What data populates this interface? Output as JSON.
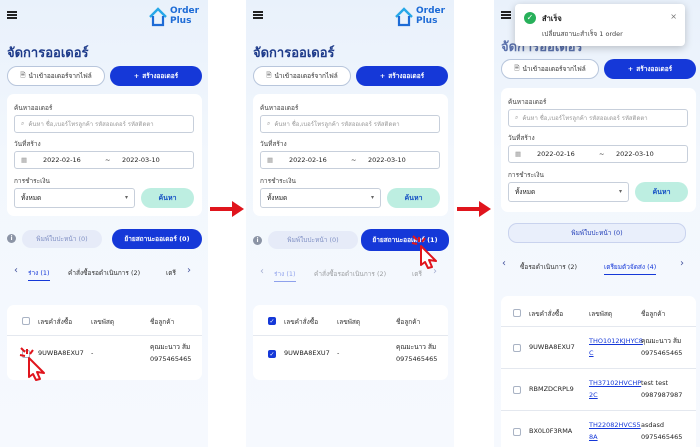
{
  "brand": {
    "line1": "Order",
    "line2": "Plus"
  },
  "page_title": "จัดการออเดอร์",
  "import_button": "นำเข้าออเดอร์จากไฟล์",
  "create_button": "สร้างออเดอร์",
  "search": {
    "label": "ค้นหาออเดอร์",
    "placeholder": "ค้นหา ชื่อ,เบอร์โทรลูกค้า รหัสออเดอร์ รหัสติดตา"
  },
  "date": {
    "label": "วันที่สร้าง",
    "from": "2022-02-16",
    "to": "2022-03-10",
    "sep": "~"
  },
  "payment": {
    "label": "การชำระเงิน",
    "value": "ทั้งหมด"
  },
  "search_button": "ค้นหา",
  "print_button": "พิมพ์ใบปะหน้า (0)",
  "move_button_0": "ย้ายสถานะออเดอร์ (0)",
  "move_button_1": "ย้ายสถานะออเดอร์ (1)",
  "tabs_p1": {
    "t1": "ร่าง (1)",
    "t2": "คำสั่งซื้อรอดำเนินการ (2)",
    "t3": "เตรี"
  },
  "tabs_p3": {
    "t1": "ซื้อรอดำเนินการ (2)",
    "t2": "เตรียมตัวจัดส่ง (4)"
  },
  "list_headers": {
    "order_no": "เลขคำสั่งซื้อ",
    "parcel_no": "เลขพัสดุ",
    "customer": "ชื่อลูกค้า"
  },
  "draft_row": {
    "order_no": "9UWBA8EXU7",
    "parcel_no": "-",
    "customer_name": "คุณมะนาว ส้ม",
    "customer_phone": "0975465465"
  },
  "ship_rows": [
    {
      "order_no": "9UWBA8EXU7",
      "parcel_l1": "THO1012KJHYC8",
      "parcel_l2": "C",
      "customer_l1": "คุณมะนาว ส้ม",
      "customer_l2": "0975465465"
    },
    {
      "order_no": "RBMZDCRPL9",
      "parcel_l1": "TH37102HVCHP",
      "parcel_l2": "2C",
      "customer_l1": "test test",
      "customer_l2": "0987987987"
    },
    {
      "order_no": "BX0L0F3RMA",
      "parcel_l1": "TH22082HVCS5",
      "parcel_l2": "8A",
      "customer_l1": "asdasd",
      "customer_l2": "0975465465"
    }
  ],
  "toast": {
    "title": "สำเร็จ",
    "message": "เปลี่ยนสถานะสำเร็จ 1 order",
    "close": "×"
  },
  "colors": {
    "primary": "#1538d8",
    "accent_green": "#bdeee1",
    "arrow": "#e0151d",
    "success": "#27b05a"
  }
}
